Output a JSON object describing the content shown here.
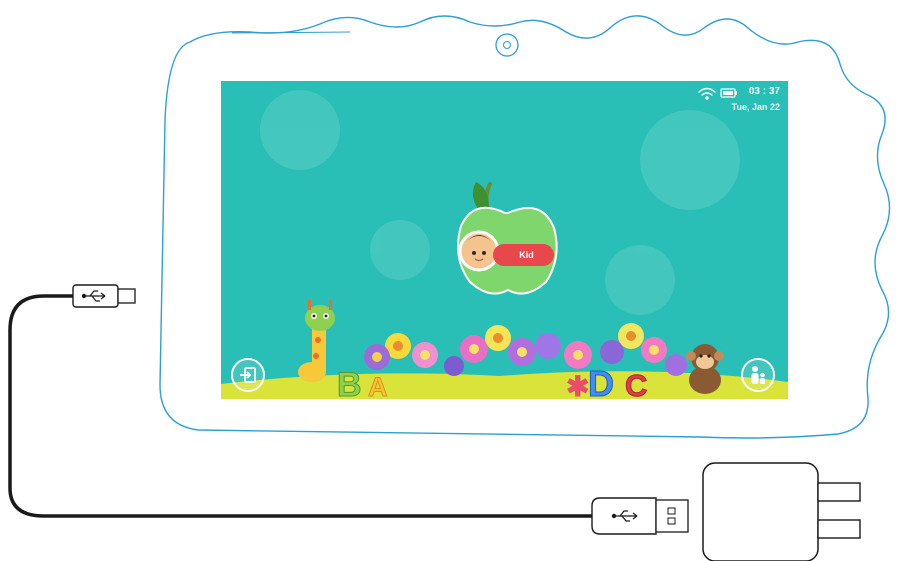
{
  "status_bar": {
    "time": "03 : 37",
    "date": "Tue, Jan 22"
  },
  "profile": {
    "name": "Kid"
  },
  "letters": [
    "B",
    "A",
    "D",
    "C"
  ],
  "icons": {
    "wifi": "wifi-icon",
    "battery": "battery-icon",
    "exit": "exit-icon",
    "parent": "parent-icon",
    "usb": "usb-icon"
  },
  "colors": {
    "screen_bg": "#29bfb6",
    "tablet_outline": "#2c9fd6",
    "apple": "#7fd66c",
    "pill": "#e8474b",
    "ground": "#d9e33a"
  }
}
